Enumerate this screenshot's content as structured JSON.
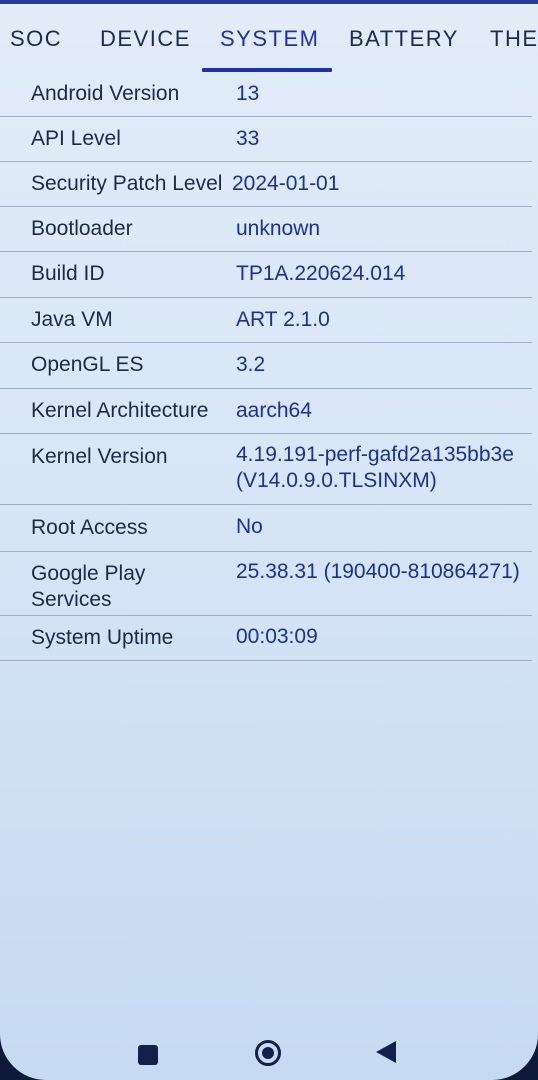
{
  "tabs": [
    {
      "label": "SOC"
    },
    {
      "label": "DEVICE"
    },
    {
      "label": "SYSTEM"
    },
    {
      "label": "BATTERY"
    },
    {
      "label": "THE"
    }
  ],
  "active_tab": "SYSTEM",
  "accent_color": "#1f2fb8",
  "rows": [
    {
      "label": "Android Version",
      "value": "13"
    },
    {
      "label": "API Level",
      "value": "33"
    },
    {
      "label": "Security Patch Level",
      "value": "2024-01-01"
    },
    {
      "label": "Bootloader",
      "value": "unknown"
    },
    {
      "label": "Build ID",
      "value": "TP1A.220624.014"
    },
    {
      "label": "Java VM",
      "value": "ART 2.1.0"
    },
    {
      "label": "OpenGL ES",
      "value": "3.2"
    },
    {
      "label": "Kernel Architecture",
      "value": "aarch64"
    },
    {
      "label": "Kernel Version",
      "value": "4.19.191-perf-gafd2a135bb3e\n(V14.0.9.0.TLSINXM)"
    },
    {
      "label": "Root Access",
      "value": "No"
    },
    {
      "label": "Google Play\nServices",
      "value": "25.38.31 (190400-810864271)"
    },
    {
      "label": "System Uptime",
      "value": "00:03:09"
    }
  ],
  "navbar": {
    "recents_icon": "square-icon",
    "home_icon": "circle-home-icon",
    "back_icon": "triangle-back-icon"
  }
}
